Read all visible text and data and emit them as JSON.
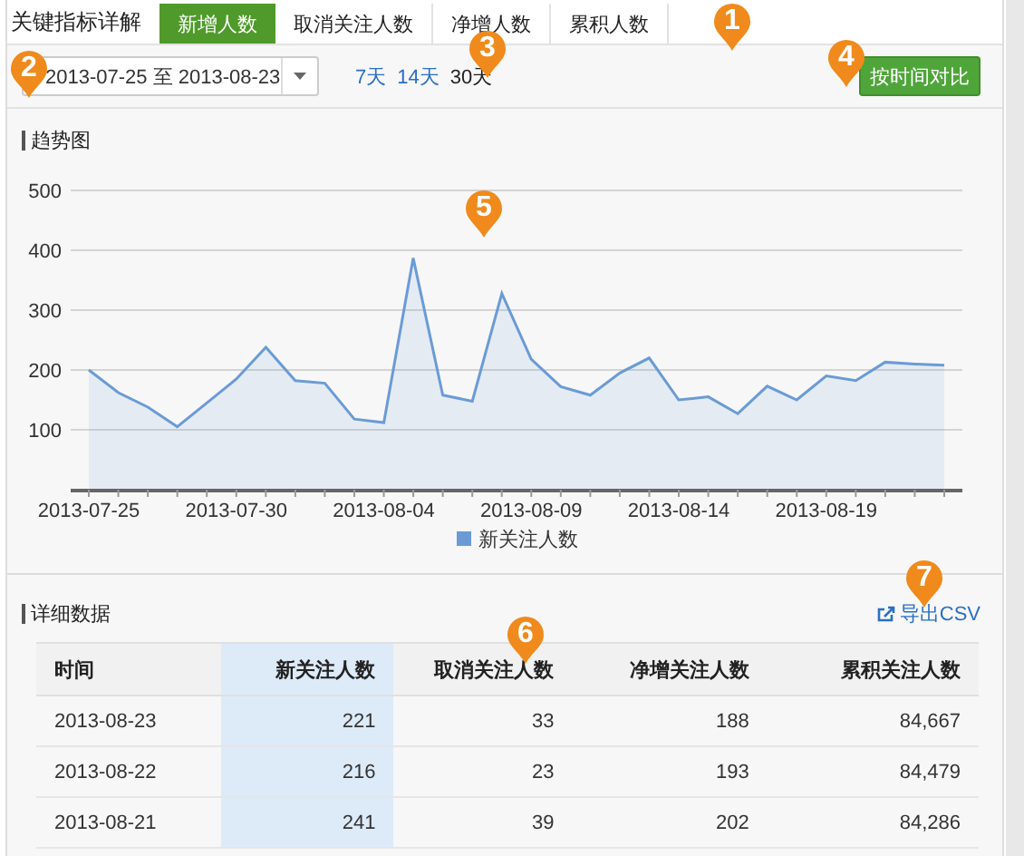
{
  "header": {
    "title": "关键指标详解",
    "tabs": [
      {
        "label": "新增人数",
        "selected": true
      },
      {
        "label": "取消关注人数",
        "selected": false
      },
      {
        "label": "净增人数",
        "selected": false
      },
      {
        "label": "累积人数",
        "selected": false
      }
    ]
  },
  "toolbar": {
    "date_range": "2013-07-25 至 2013-08-23",
    "ranges": [
      {
        "label": "7天",
        "selected": false
      },
      {
        "label": "14天",
        "selected": false
      },
      {
        "label": "30天",
        "selected": true
      }
    ],
    "compare_button": "按时间对比"
  },
  "trend": {
    "title": "趋势图",
    "chart_data": {
      "type": "area",
      "grid": true,
      "categories": [
        "2013-07-25",
        null,
        null,
        null,
        null,
        "2013-07-30",
        null,
        null,
        null,
        null,
        "2013-08-04",
        null,
        null,
        null,
        null,
        "2013-08-09",
        null,
        null,
        null,
        null,
        "2013-08-14",
        null,
        null,
        null,
        null,
        "2013-08-19",
        null,
        null,
        null,
        null
      ],
      "series": [
        {
          "name": "新关注人数",
          "color": "#6a9bd6",
          "values": [
            200,
            162,
            138,
            105,
            145,
            185,
            238,
            182,
            178,
            118,
            112,
            387,
            158,
            148,
            328,
            218,
            172,
            158,
            195,
            220,
            150,
            155,
            127,
            173,
            150,
            190,
            182,
            213,
            210,
            208
          ]
        }
      ],
      "ylim": [
        0,
        500
      ],
      "yticks": [
        100,
        200,
        300,
        400,
        500
      ]
    }
  },
  "details": {
    "title": "详细数据",
    "export_link": "导出CSV",
    "table": {
      "columns": [
        {
          "label": "时间",
          "highlighted": false
        },
        {
          "label": "新关注人数",
          "highlighted": true
        },
        {
          "label": "取消关注人数",
          "highlighted": false
        },
        {
          "label": "净增关注人数",
          "highlighted": false
        },
        {
          "label": "累积关注人数",
          "highlighted": false
        }
      ],
      "rows": [
        [
          "2013-08-23",
          "221",
          "33",
          "188",
          "84,667"
        ],
        [
          "2013-08-22",
          "216",
          "23",
          "193",
          "84,479"
        ],
        [
          "2013-08-21",
          "241",
          "39",
          "202",
          "84,286"
        ]
      ]
    }
  },
  "pins": [
    "1",
    "2",
    "3",
    "4",
    "5",
    "6",
    "7"
  ]
}
